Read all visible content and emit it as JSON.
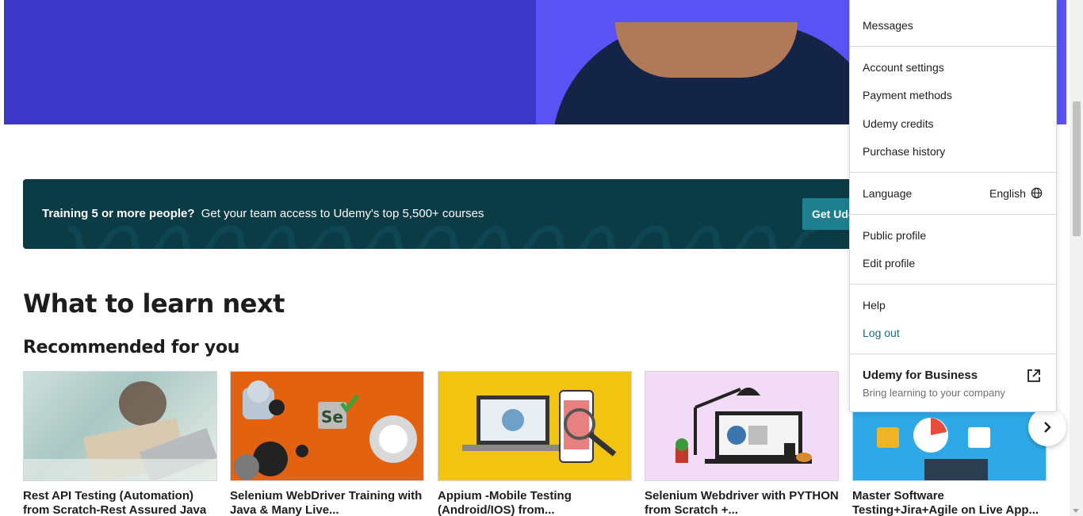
{
  "banner": {
    "bold_text": "Training 5 or more people?",
    "text": "Get your team access to Udemy's top 5,500+ courses",
    "button_label": "Get Udemy for Business"
  },
  "sections": {
    "what_to_learn": "What to learn next",
    "recommended": "Recommended for you"
  },
  "courses": [
    {
      "title": "Rest API Testing (Automation) from Scratch-Rest Assured Java"
    },
    {
      "title": "Selenium WebDriver Training with Java & Many Live..."
    },
    {
      "title": "Appium -Mobile Testing (Android/IOS) from..."
    },
    {
      "title": "Selenium Webdriver with PYTHON from Scratch +..."
    },
    {
      "title": "Master Software Testing+Jira+Agile on Live App..."
    }
  ],
  "menu": {
    "messages": "Messages",
    "account_settings": "Account settings",
    "payment_methods": "Payment methods",
    "udemy_credits": "Udemy credits",
    "purchase_history": "Purchase history",
    "language_label": "Language",
    "language_value": "English",
    "public_profile": "Public profile",
    "edit_profile": "Edit profile",
    "help": "Help",
    "log_out": "Log out",
    "business_title": "Udemy for Business",
    "business_subtitle": "Bring learning to your company"
  },
  "colors": {
    "hero_left": "#3b37c7",
    "hero_right": "#5a52f5",
    "banner_bg": "#0b3b45",
    "banner_button": "#1e7f8f",
    "logout_link": "#1e6b8a"
  }
}
